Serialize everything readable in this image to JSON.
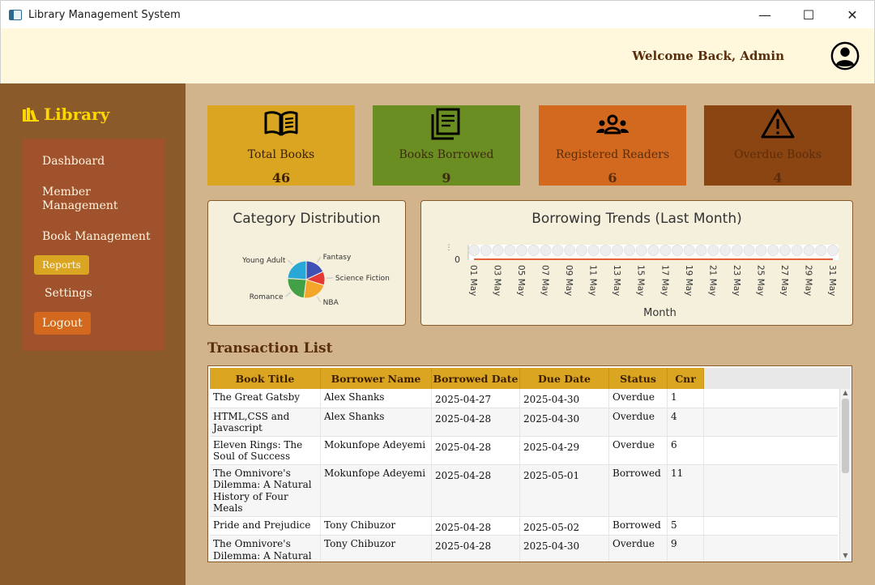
{
  "window": {
    "title": "Library Management System",
    "controls": {
      "minimize": "—",
      "maximize": "☐",
      "close": "✕"
    }
  },
  "header": {
    "welcome": "Welcome Back, Admin",
    "avatar_icon": "user-circle-icon"
  },
  "sidebar": {
    "brand": "Library",
    "brand_icon": "books-icon",
    "items": [
      {
        "label": "Dashboard"
      },
      {
        "label": "Member Management"
      },
      {
        "label": "Book Management"
      },
      {
        "label": "Reports"
      },
      {
        "label": "Settings"
      },
      {
        "label": "Logout"
      }
    ]
  },
  "stats": [
    {
      "label": "Total Books",
      "value": "46",
      "icon": "open-book-icon",
      "bg": "#daa520",
      "fg": "#3d1f00"
    },
    {
      "label": "Books Borrowed",
      "value": "9",
      "icon": "documents-icon",
      "bg": "#6b8e23",
      "fg": "#3d2a10"
    },
    {
      "label": "Registered Readers",
      "value": "6",
      "icon": "people-icon",
      "bg": "#d2691e",
      "fg": "#5a2d0c"
    },
    {
      "label": "Overdue Books",
      "value": "4",
      "icon": "warning-icon",
      "bg": "#8b4513",
      "fg": "#5e2c08"
    }
  ],
  "category_chart": {
    "title": "Category Distribution",
    "chart_data": {
      "type": "pie",
      "labels": [
        "Fantasy",
        "Science Fiction",
        "NBA",
        "Romance",
        "Young Adult"
      ],
      "values": [
        18,
        12,
        22,
        24,
        24
      ],
      "colors": [
        "#3f51b5",
        "#e53935",
        "#f4a62a",
        "#43a047",
        "#29a8d8"
      ]
    }
  },
  "trend_chart": {
    "title": "Borrowing Trends (Last Month)",
    "chart_data": {
      "type": "line",
      "xlabel": "Month",
      "ylabel": "",
      "ytick": "0",
      "x_tick_labels": [
        "01 May",
        "03 May",
        "05 May",
        "07 May",
        "09 May",
        "11 May",
        "13 May",
        "15 May",
        "17 May",
        "19 May",
        "21 May",
        "23 May",
        "25 May",
        "27 May",
        "29 May",
        "31 May"
      ],
      "x": [
        "01 May",
        "02 May",
        "03 May",
        "04 May",
        "05 May",
        "06 May",
        "07 May",
        "08 May",
        "09 May",
        "10 May",
        "11 May",
        "12 May",
        "13 May",
        "14 May",
        "15 May",
        "16 May",
        "17 May",
        "18 May",
        "19 May",
        "20 May",
        "21 May",
        "22 May",
        "23 May",
        "24 May",
        "25 May",
        "26 May",
        "27 May",
        "28 May",
        "29 May",
        "30 May",
        "31 May"
      ],
      "values": [
        0,
        0,
        0,
        0,
        0,
        0,
        0,
        0,
        0,
        0,
        0,
        0,
        0,
        0,
        0,
        0,
        0,
        0,
        0,
        0,
        0,
        0,
        0,
        0,
        0,
        0,
        0,
        0,
        0,
        0,
        0
      ],
      "line_color": "#e8603c"
    }
  },
  "transactions": {
    "title": "Transaction List",
    "columns": [
      "Book Title",
      "Borrower Name",
      "Borrowed Date",
      "Due Date",
      "Status",
      "Cnr"
    ],
    "rows": [
      [
        "The Great Gatsby",
        "Alex Shanks",
        "2025-04-27",
        "2025-04-30",
        "Overdue",
        "1"
      ],
      [
        "HTML,CSS and Javascript",
        "Alex Shanks",
        "2025-04-28",
        "2025-04-30",
        "Overdue",
        "4"
      ],
      [
        "Eleven Rings: The Soul of Success",
        "Mokunfope Adeyemi",
        "2025-04-28",
        "2025-04-29",
        "Overdue",
        "6"
      ],
      [
        "The Omnivore's Dilemma: A Natural History of Four Meals",
        "Mokunfope Adeyemi",
        "2025-04-28",
        "2025-05-01",
        "Borrowed",
        "11"
      ],
      [
        "Pride and Prejudice",
        "Tony Chibuzor",
        "2025-04-28",
        "2025-05-02",
        "Borrowed",
        "5"
      ],
      [
        "The Omnivore's Dilemma: A Natural History of Four Meals",
        "Tony Chibuzor",
        "2025-04-28",
        "2025-04-30",
        "Overdue",
        "9"
      ]
    ]
  }
}
